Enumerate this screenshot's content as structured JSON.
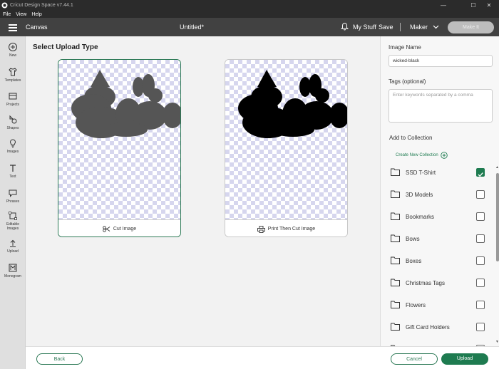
{
  "window": {
    "title": "Cricut Design Space  v7.44.1",
    "min_glyph": "—",
    "max_glyph": "☐",
    "close_glyph": "✕"
  },
  "menu": [
    "File",
    "View",
    "Help"
  ],
  "header": {
    "canvas_label": "Canvas",
    "doc_title": "Untitled*",
    "my_stuff": "My Stuff",
    "save": "Save",
    "machine": "Maker",
    "make_it": "Make It"
  },
  "left_nav": [
    {
      "label": "New",
      "icon": "plus-circle-icon"
    },
    {
      "label": "Templates",
      "icon": "shirt-icon"
    },
    {
      "label": "Projects",
      "icon": "projects-icon"
    },
    {
      "label": "Shapes",
      "icon": "shapes-icon"
    },
    {
      "label": "Images",
      "icon": "lightbulb-icon"
    },
    {
      "label": "Text",
      "icon": "text-icon"
    },
    {
      "label": "Phrases",
      "icon": "speech-bubble-icon"
    },
    {
      "label": "Editable\nImages",
      "icon": "editable-images-icon"
    },
    {
      "label": "Upload",
      "icon": "upload-icon"
    },
    {
      "label": "Monogram",
      "icon": "monogram-icon"
    }
  ],
  "main": {
    "heading": "Select Upload Type",
    "cards": [
      {
        "label": "Cut Image",
        "icon": "scissors-icon",
        "selected": true,
        "fill": "#555555"
      },
      {
        "label": "Print Then Cut Image",
        "icon": "printer-icon",
        "selected": false,
        "fill": "#000000"
      }
    ]
  },
  "right_panel": {
    "image_name_label": "Image Name",
    "image_name_value": "wicked-black",
    "tags_label": "Tags (optional)",
    "tags_placeholder": "Enter keywords separated by a comma",
    "collection_label": "Add to Collection",
    "create_new": "Create New Collection",
    "collections": [
      {
        "name": "SSD T-Shirt",
        "checked": true
      },
      {
        "name": "3D Models",
        "checked": false
      },
      {
        "name": "Bookmarks",
        "checked": false
      },
      {
        "name": "Bows",
        "checked": false
      },
      {
        "name": "Boxes",
        "checked": false
      },
      {
        "name": "Christmas Tags",
        "checked": false
      },
      {
        "name": "Flowers",
        "checked": false
      },
      {
        "name": "Gift Card Holders",
        "checked": false
      },
      {
        "name": "Organization",
        "checked": false
      }
    ]
  },
  "footer": {
    "back": "Back",
    "cancel": "Cancel",
    "upload": "Upload"
  },
  "colors": {
    "accent": "#1e7b50",
    "header_bg": "#414141",
    "titlebar_bg": "#2b2b2b"
  }
}
